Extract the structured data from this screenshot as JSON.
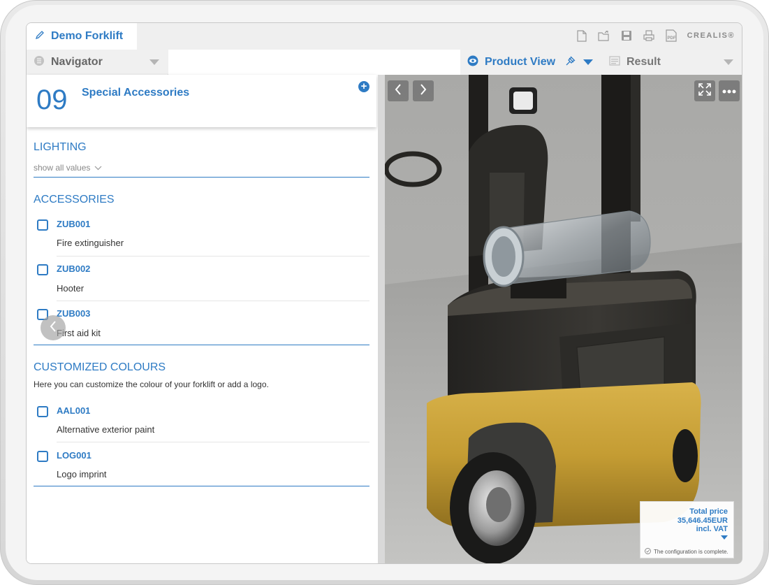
{
  "app": {
    "tab_title": "Demo Forklift",
    "brand": "CREALIS®"
  },
  "toolbar": {
    "icons": [
      "new-document-icon",
      "open-folder-icon",
      "save-icon",
      "print-icon",
      "pdf-export-icon"
    ]
  },
  "header": {
    "navigator_label": "Navigator",
    "product_view_label": "Product View",
    "result_label": "Result"
  },
  "section": {
    "number": "09",
    "title": "Special Accessories"
  },
  "groups": {
    "lighting": {
      "title": "LIGHTING",
      "show_all": "show all values"
    },
    "accessories": {
      "title": "ACCESSORIES",
      "options": [
        {
          "code": "ZUB001",
          "description": "Fire extinguisher",
          "checked": false
        },
        {
          "code": "ZUB002",
          "description": "Hooter",
          "checked": false
        },
        {
          "code": "ZUB003",
          "description": "First aid kit",
          "checked": false
        }
      ]
    },
    "colours": {
      "title": "CUSTOMIZED COLOURS",
      "description": "Here you can customize the colour of your forklift or add a logo.",
      "options": [
        {
          "code": "AAL001",
          "description": "Alternative exterior paint",
          "checked": false
        },
        {
          "code": "LOG001",
          "description": "Logo imprint",
          "checked": false
        }
      ]
    }
  },
  "price": {
    "label": "Total price",
    "value": "35,646.45EUR",
    "vat": "incl. VAT",
    "status": "The configuration is complete."
  },
  "colors": {
    "accent": "#2e7bc4",
    "forklift_yellow": "#c7a23a",
    "forklift_body": "#2e2c29"
  }
}
